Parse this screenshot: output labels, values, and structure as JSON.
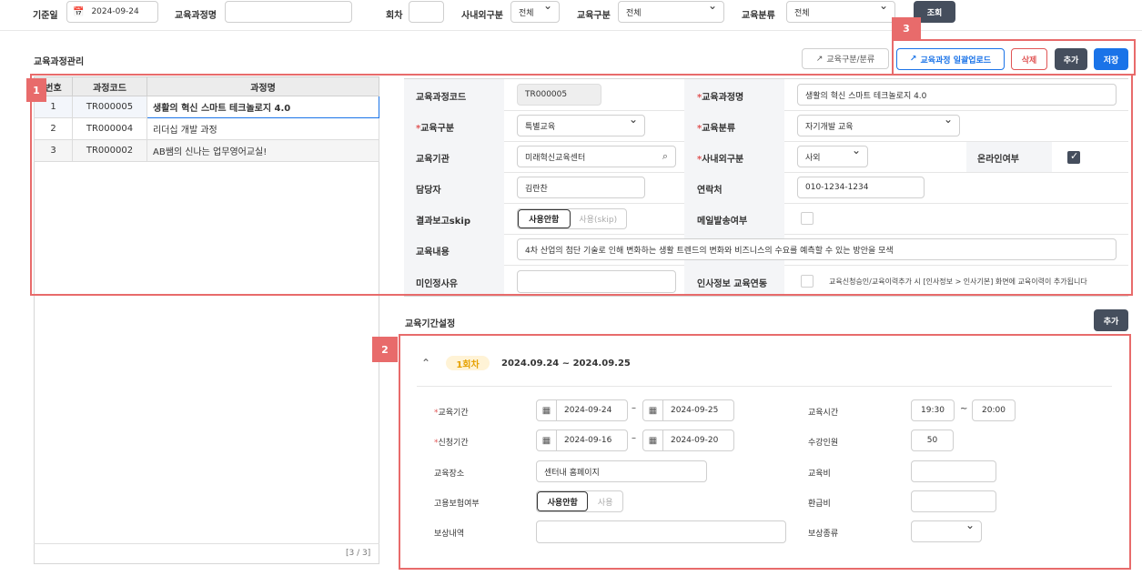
{
  "search_bar": {
    "base_date_label": "기준일",
    "base_date_value": "2024-09-24",
    "course_name_label": "교육과정명",
    "course_name_value": "",
    "round_label": "회차",
    "round_value": "",
    "inout_label": "사내외구분",
    "inout_value": "전체",
    "edu_type_label": "교육구분",
    "edu_type_value": "전체",
    "edu_class_label": "교육분류",
    "edu_class_value": "전체",
    "search_button": "조회"
  },
  "section_title": "교육과정관리",
  "toolbar": {
    "category_button": "교육구분/분류",
    "bulk_upload_button": "교육과정 일괄업로드",
    "delete_button": "삭제",
    "add_button": "추가",
    "save_button": "저장"
  },
  "annotations": {
    "tag1": "1",
    "tag2": "2",
    "tag3": "3"
  },
  "course_table": {
    "headers": [
      "번호",
      "과정코드",
      "과정명"
    ],
    "rows": [
      {
        "no": "1",
        "code": "TR000005",
        "name": "생활의 혁신 스마트 테크놀로지 4.0"
      },
      {
        "no": "2",
        "code": "TR000004",
        "name": "리더십 개발 과정"
      },
      {
        "no": "3",
        "code": "TR000002",
        "name": "AB쌤의 신나는 업무영어교실!"
      }
    ],
    "pager": "[3 / 3]"
  },
  "detail": {
    "course_code_label": "교육과정코드",
    "course_code_value": "TR000005",
    "course_name_label": "교육과정명",
    "course_name_value": "생활의 혁신 스마트 테크놀로지 4.0",
    "edu_type_label": "교육구분",
    "edu_type_value": "특별교육",
    "edu_class_label": "교육분류",
    "edu_class_value": "자기개발 교육",
    "institution_label": "교육기관",
    "institution_value": "미래혁신교육센터",
    "inout_label": "사내외구분",
    "inout_value": "사외",
    "online_label": "온라인여부",
    "manager_label": "담당자",
    "manager_value": "김란찬",
    "contact_label": "연락처",
    "contact_value": "010-1234-1234",
    "skip_label": "결과보고skip",
    "skip_on": "사용안함",
    "skip_off": "사용(skip)",
    "mail_label": "메일발송여부",
    "content_label": "교육내용",
    "content_value": "4차 산업의 첨단 기술로 인해 변화하는 생활 트렌드의 변화와 비즈니스의 수요를 예측할 수 있는 방안을 모색",
    "reject_label": "미인정사유",
    "reject_value": "",
    "hr_link_label": "인사정보 교육연동",
    "hr_link_note": "교육신청승인/교육이력추가 시 [인사정보 > 인사기본] 화면에 교육이력이 추가됩니다"
  },
  "period": {
    "title": "교육기간설정",
    "add_button": "추가",
    "round_badge": "1회차",
    "round_range": "2024.09.24 ~ 2024.09.25",
    "edu_period_label": "교육기간",
    "edu_start": "2024-09-24",
    "edu_end": "2024-09-25",
    "dash": "–",
    "apply_period_label": "신청기간",
    "apply_start": "2024-09-16",
    "apply_end": "2024-09-20",
    "place_label": "교육장소",
    "place_value": "센터내 홈페이지",
    "insurance_label": "고용보험여부",
    "insurance_on": "사용안함",
    "insurance_off": "사용",
    "reward_label": "보상내역",
    "reward_value": "",
    "time_label": "교육시간",
    "time_start": "19:30",
    "time_tilde": "~",
    "time_end": "20:00",
    "capacity_label": "수강인원",
    "capacity_value": "50",
    "fee_label": "교육비",
    "fee_value": "",
    "refund_label": "환급비",
    "refund_value": "",
    "reward_type_label": "보상종류",
    "reward_type_value": ""
  }
}
